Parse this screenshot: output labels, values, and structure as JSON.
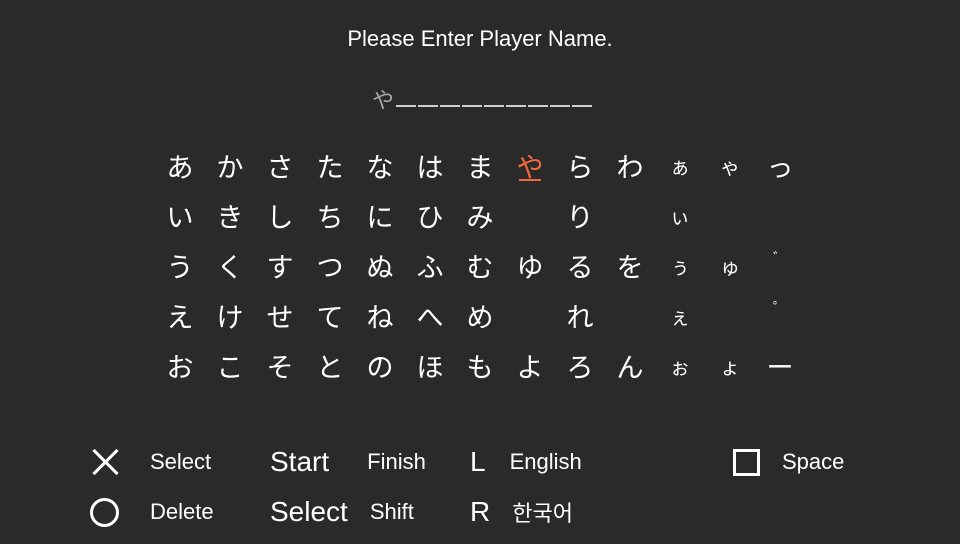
{
  "prompt": "Please Enter Player Name.",
  "name_entry": {
    "entered": "や",
    "blank_count": 9
  },
  "selected_kana": "や",
  "kana_rows": [
    [
      "あ",
      "か",
      "さ",
      "た",
      "な",
      "は",
      "ま",
      "や",
      "ら",
      "わ",
      "ぁ",
      "ゃ",
      "っ"
    ],
    [
      "い",
      "き",
      "し",
      "ち",
      "に",
      "ひ",
      "み",
      "",
      "り",
      "",
      "ぃ",
      "",
      ""
    ],
    [
      "う",
      "く",
      "す",
      "つ",
      "ぬ",
      "ふ",
      "む",
      "ゆ",
      "る",
      "を",
      "ぅ",
      "ゅ",
      "゛"
    ],
    [
      "え",
      "け",
      "せ",
      "て",
      "ね",
      "へ",
      "め",
      "",
      "れ",
      "",
      "ぇ",
      "",
      "゜"
    ],
    [
      "お",
      "こ",
      "そ",
      "と",
      "の",
      "ほ",
      "も",
      "よ",
      "ろ",
      "ん",
      "ぉ",
      "ょ",
      "ー"
    ]
  ],
  "controls": {
    "cross": "Select",
    "circle": "Delete",
    "start_key": "Start",
    "start_action": "Finish",
    "select_key": "Select",
    "select_action": "Shift",
    "l_key": "L",
    "l_action": "English",
    "r_key": "R",
    "r_action": "한국어",
    "square": "Space"
  },
  "colors": {
    "background": "#2a2a2a",
    "text": "#ffffff",
    "highlight": "#f06a3c"
  }
}
